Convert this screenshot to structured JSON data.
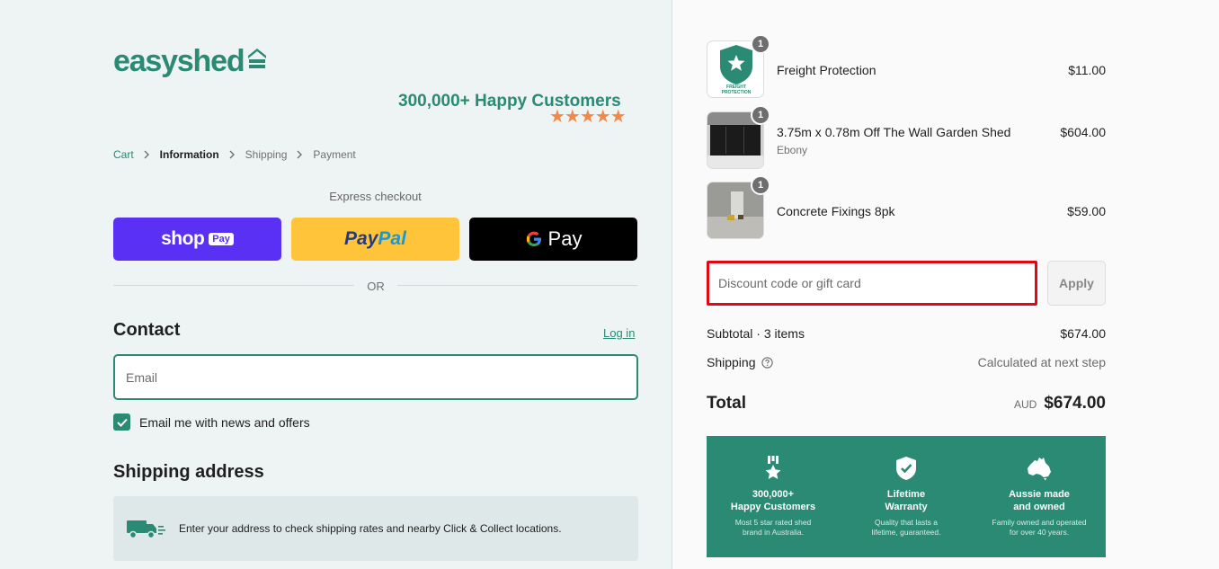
{
  "brand": {
    "name": "easyshed",
    "accent": "#2a8a73"
  },
  "header": {
    "happy_text": "300,000+  Happy Customers",
    "stars": "★★★★★"
  },
  "breadcrumb": {
    "cart": "Cart",
    "information": "Information",
    "shipping": "Shipping",
    "payment": "Payment"
  },
  "express": {
    "label": "Express checkout",
    "shop_pay": {
      "word": "shop",
      "badge": "Pay"
    },
    "paypal": {
      "part1": "Pay",
      "part2": "Pal"
    },
    "gpay": {
      "word": "Pay"
    },
    "or": "OR"
  },
  "contact": {
    "title": "Contact",
    "login": "Log in",
    "email_placeholder": "Email",
    "newsletter_label": "Email me with news and offers",
    "newsletter_checked": true
  },
  "shipping_address": {
    "title": "Shipping address",
    "notice": "Enter your address to check shipping rates and nearby Click & Collect locations.",
    "icon": "truck-icon"
  },
  "cart": {
    "items": [
      {
        "name": "Freight Protection",
        "variant": "",
        "price": "$11.00",
        "qty": "1"
      },
      {
        "name": "3.75m x 0.78m Off The Wall Garden Shed",
        "variant": "Ebony",
        "price": "$604.00",
        "qty": "1"
      },
      {
        "name": "Concrete Fixings 8pk",
        "variant": "",
        "price": "$59.00",
        "qty": "1"
      }
    ],
    "freight_badge": {
      "line1": "FREIGHT",
      "line2": "PROTECTION"
    }
  },
  "discount": {
    "placeholder": "Discount code or gift card",
    "apply": "Apply"
  },
  "summary": {
    "subtotal_label": "Subtotal · 3 items",
    "subtotal_value": "$674.00",
    "shipping_label": "Shipping",
    "shipping_value": "Calculated at next step",
    "total_label": "Total",
    "currency": "AUD",
    "total_value": "$674.00"
  },
  "features": [
    {
      "title": "300,000+",
      "title2": "Happy Customers",
      "sub": "Most 5 star rated shed",
      "sub2": "brand in Australia.",
      "icon": "medal-star-icon"
    },
    {
      "title": "Lifetime",
      "title2": "Warranty",
      "sub": "Quality that lasts a",
      "sub2": "lifetime, guaranteed.",
      "icon": "shield-check-icon"
    },
    {
      "title": "Aussie made",
      "title2": "and owned",
      "sub": "Family owned and operated",
      "sub2": "for over 40 years.",
      "icon": "australia-map-icon"
    }
  ]
}
